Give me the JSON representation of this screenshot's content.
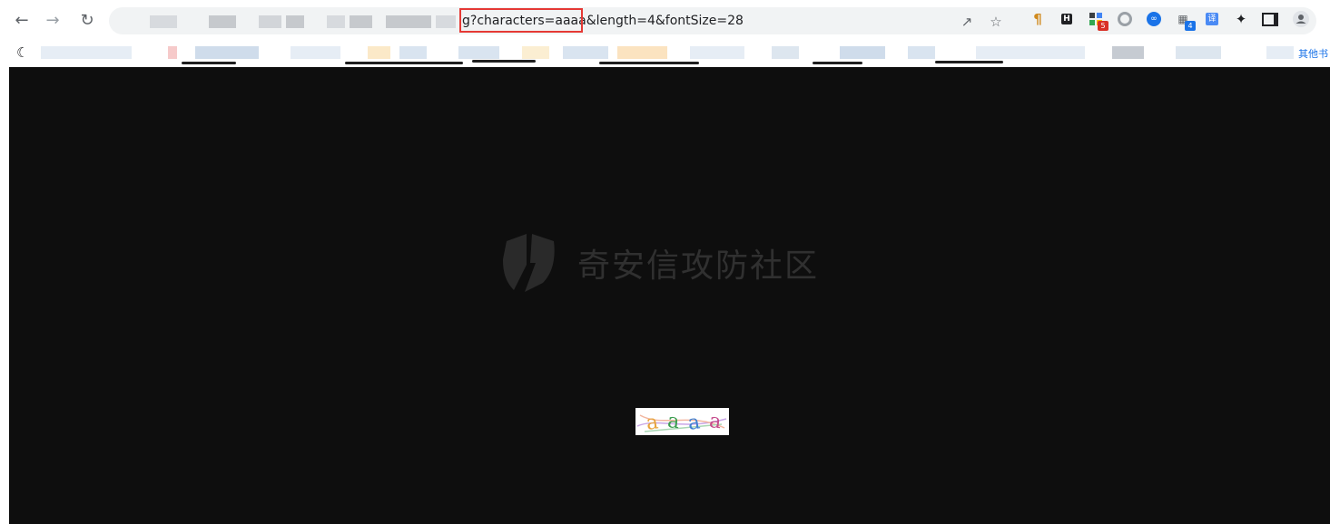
{
  "browser": {
    "back_icon": "arrow-left-icon",
    "forward_icon": "arrow-right-icon",
    "reload_icon": "reload-icon",
    "url_visible": "g?characters=aaaa&length=4&fontSize=28",
    "share_icon": "share-icon",
    "bookmark_star_icon": "star-icon",
    "extensions": [
      {
        "name": "pilcrow-extension-icon"
      },
      {
        "name": "h-extension-icon"
      },
      {
        "name": "apps-extension-icon",
        "badge": "5"
      },
      {
        "name": "circle-extension-icon"
      },
      {
        "name": "mask-extension-icon"
      },
      {
        "name": "grid-extension-icon",
        "badge": "4"
      },
      {
        "name": "translate-extension-icon",
        "label": "译"
      },
      {
        "name": "puzzle-icon"
      },
      {
        "name": "side-panel-icon"
      },
      {
        "name": "profile-avatar-icon"
      }
    ]
  },
  "bookmarks_bar": {
    "first_icon": "moon-icon",
    "other_bookmarks_label": "其他书"
  },
  "page": {
    "watermark_text": "奇安信攻防社区",
    "captcha": {
      "characters": [
        "a",
        "a",
        "a",
        "a"
      ],
      "colors": [
        "#e8a33d",
        "#3a9d4f",
        "#3f7fd0",
        "#c64b8c"
      ]
    }
  },
  "colors": {
    "page_background": "#0e0e0e",
    "highlight_box": "#e53935",
    "omnibox_bg": "#f1f3f4"
  }
}
